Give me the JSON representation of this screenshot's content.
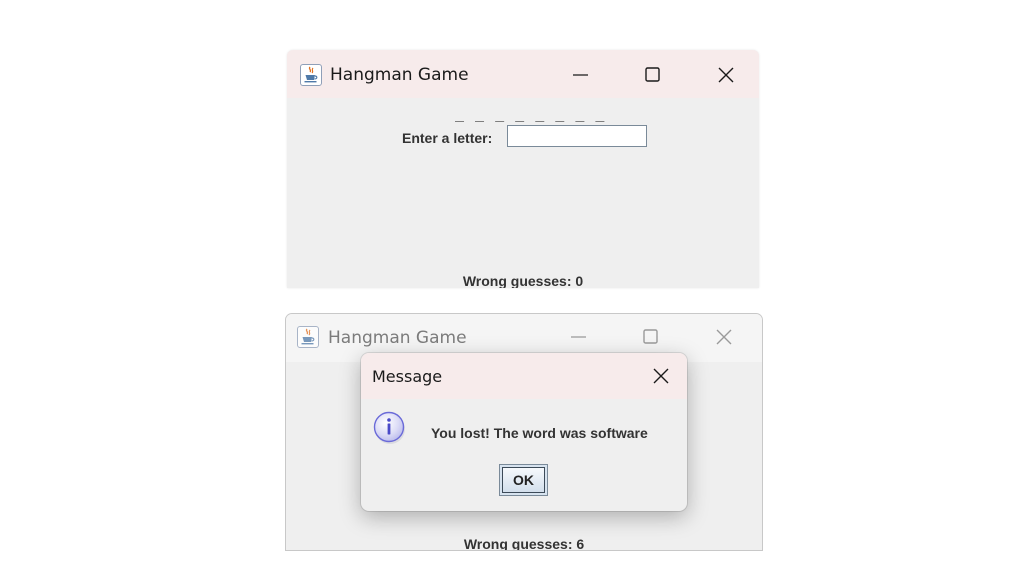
{
  "window_main": {
    "title": "Hangman Game",
    "word_display": "_ _ _ _ _ _ _ _",
    "prompt_label": "Enter a letter:",
    "letter_input_value": "",
    "wrong_guesses": "Wrong guesses: 0"
  },
  "window_end": {
    "title": "Hangman Game",
    "wrong_guesses": "Wrong guesses: 6"
  },
  "dialog": {
    "title": "Message",
    "message": "You lost! The word was software",
    "ok_label": "OK",
    "icon": "info-icon"
  },
  "icons": {
    "app": "java-cup-icon",
    "minimize": "minimize-icon",
    "maximize": "maximize-icon",
    "close": "close-icon"
  },
  "colors": {
    "titlebar_active": "#f7ebeb",
    "titlebar_inactive": "#f5f5f5",
    "window_bg": "#efefef",
    "info_icon": "#6a6ad8"
  }
}
